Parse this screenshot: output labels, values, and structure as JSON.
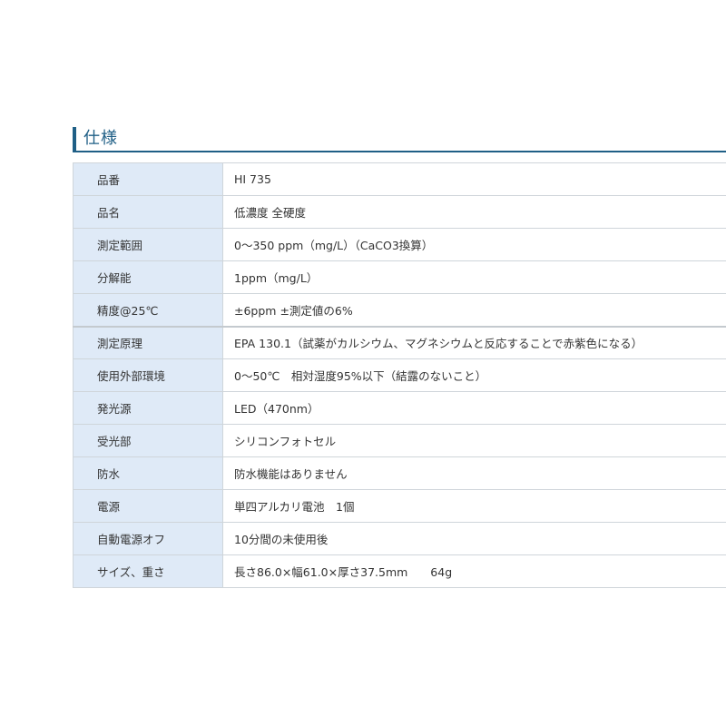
{
  "section": {
    "title": "仕様"
  },
  "specs": [
    {
      "label": "品番",
      "value": "HI 735"
    },
    {
      "label": "品名",
      "value": "低濃度 全硬度"
    },
    {
      "label": "測定範囲",
      "value": "0～350 ppm（mg/L）（CaCO3換算）"
    },
    {
      "label": "分解能",
      "value": "1ppm（mg/L）"
    },
    {
      "label": "精度@25℃",
      "value": "±6ppm ±測定値の6%"
    },
    {
      "label": "測定原理",
      "value": "EPA 130.1（試薬がカルシウム、マグネシウムと反応することで赤紫色になる）"
    },
    {
      "label": "使用外部環境",
      "value": "0～50℃　相対湿度95%以下（結露のないこと）"
    },
    {
      "label": "発光源",
      "value": "LED（470nm）"
    },
    {
      "label": "受光部",
      "value": "シリコンフォトセル"
    },
    {
      "label": "防水",
      "value": "防水機能はありません"
    },
    {
      "label": "電源",
      "value": "単四アルカリ電池　1個"
    },
    {
      "label": "自動電源オフ",
      "value": "10分間の未使用後"
    },
    {
      "label": "サイズ、重さ",
      "value": "長さ86.0×幅61.0×厚さ37.5mm　　64g"
    }
  ]
}
